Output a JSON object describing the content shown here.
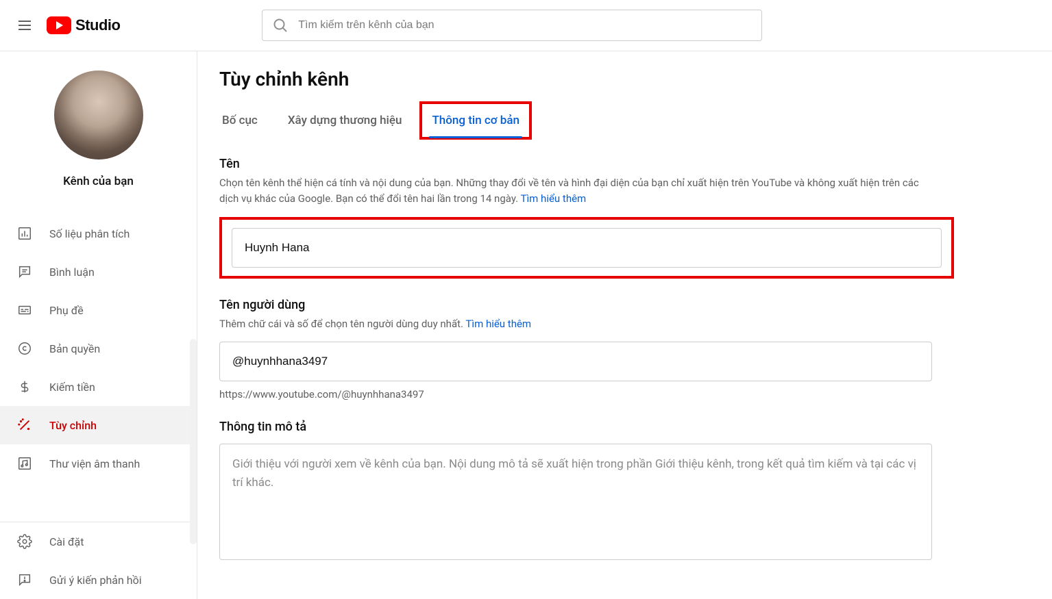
{
  "header": {
    "logo_text": "Studio",
    "search_placeholder": "Tìm kiếm trên kênh của bạn"
  },
  "sidebar": {
    "channel_label": "Kênh của bạn",
    "items": [
      {
        "label": "Số liệu phân tích"
      },
      {
        "label": "Bình luận"
      },
      {
        "label": "Phụ đề"
      },
      {
        "label": "Bản quyền"
      },
      {
        "label": "Kiếm tiền"
      },
      {
        "label": "Tùy chỉnh"
      },
      {
        "label": "Thư viện âm thanh"
      }
    ],
    "bottom": [
      {
        "label": "Cài đặt"
      },
      {
        "label": "Gửi ý kiến phản hồi"
      }
    ]
  },
  "main": {
    "page_title": "Tùy chỉnh kênh",
    "tabs": [
      {
        "label": "Bố cục"
      },
      {
        "label": "Xây dựng thương hiệu"
      },
      {
        "label": "Thông tin cơ bản"
      }
    ],
    "name_section": {
      "title": "Tên",
      "desc": "Chọn tên kênh thể hiện cá tính và nội dung của bạn. Những thay đổi về tên và hình đại diện của bạn chỉ xuất hiện trên YouTube và không xuất hiện trên các dịch vụ khác của Google. Bạn có thể đổi tên hai lần trong 14 ngày. ",
      "learn_more": "Tìm hiểu thêm",
      "value": "Huynh Hana"
    },
    "handle_section": {
      "title": "Tên người dùng",
      "desc": "Thêm chữ cái và số để chọn tên người dùng duy nhất. ",
      "learn_more": "Tìm hiểu thêm",
      "value": "@huynhhana3497",
      "url": "https://www.youtube.com/@huynhhana3497"
    },
    "desc_section": {
      "title": "Thông tin mô tả",
      "placeholder": "Giới thiệu với người xem về kênh của bạn. Nội dung mô tả sẽ xuất hiện trong phần Giới thiệu kênh, trong kết quả tìm kiếm và tại các vị trí khác."
    }
  }
}
